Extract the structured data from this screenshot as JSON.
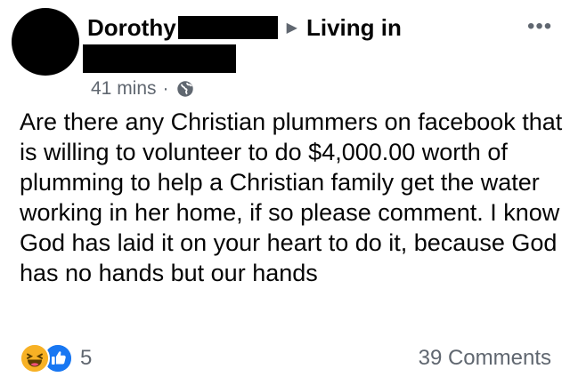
{
  "post": {
    "author": "Dorothy",
    "arrow": "▶",
    "group": "Living in",
    "time": "41 mins",
    "separator": "·",
    "more": "•••",
    "text": "Are there any Christian plummers on facebook that is willing to volunteer to do $4,000.00 worth of plumming to help a Christian family get the water working in her home, if so please comment.  I know God has laid it on your heart to do it, because God has no hands but our hands"
  },
  "footer": {
    "reaction_count": "5",
    "reaction_icons": [
      "haha-icon",
      "like-icon"
    ],
    "comments": "39 Comments"
  },
  "colors": {
    "like_blue": "#1877f2",
    "haha_yellow": "#f7b125",
    "secondary_text": "#606770"
  }
}
